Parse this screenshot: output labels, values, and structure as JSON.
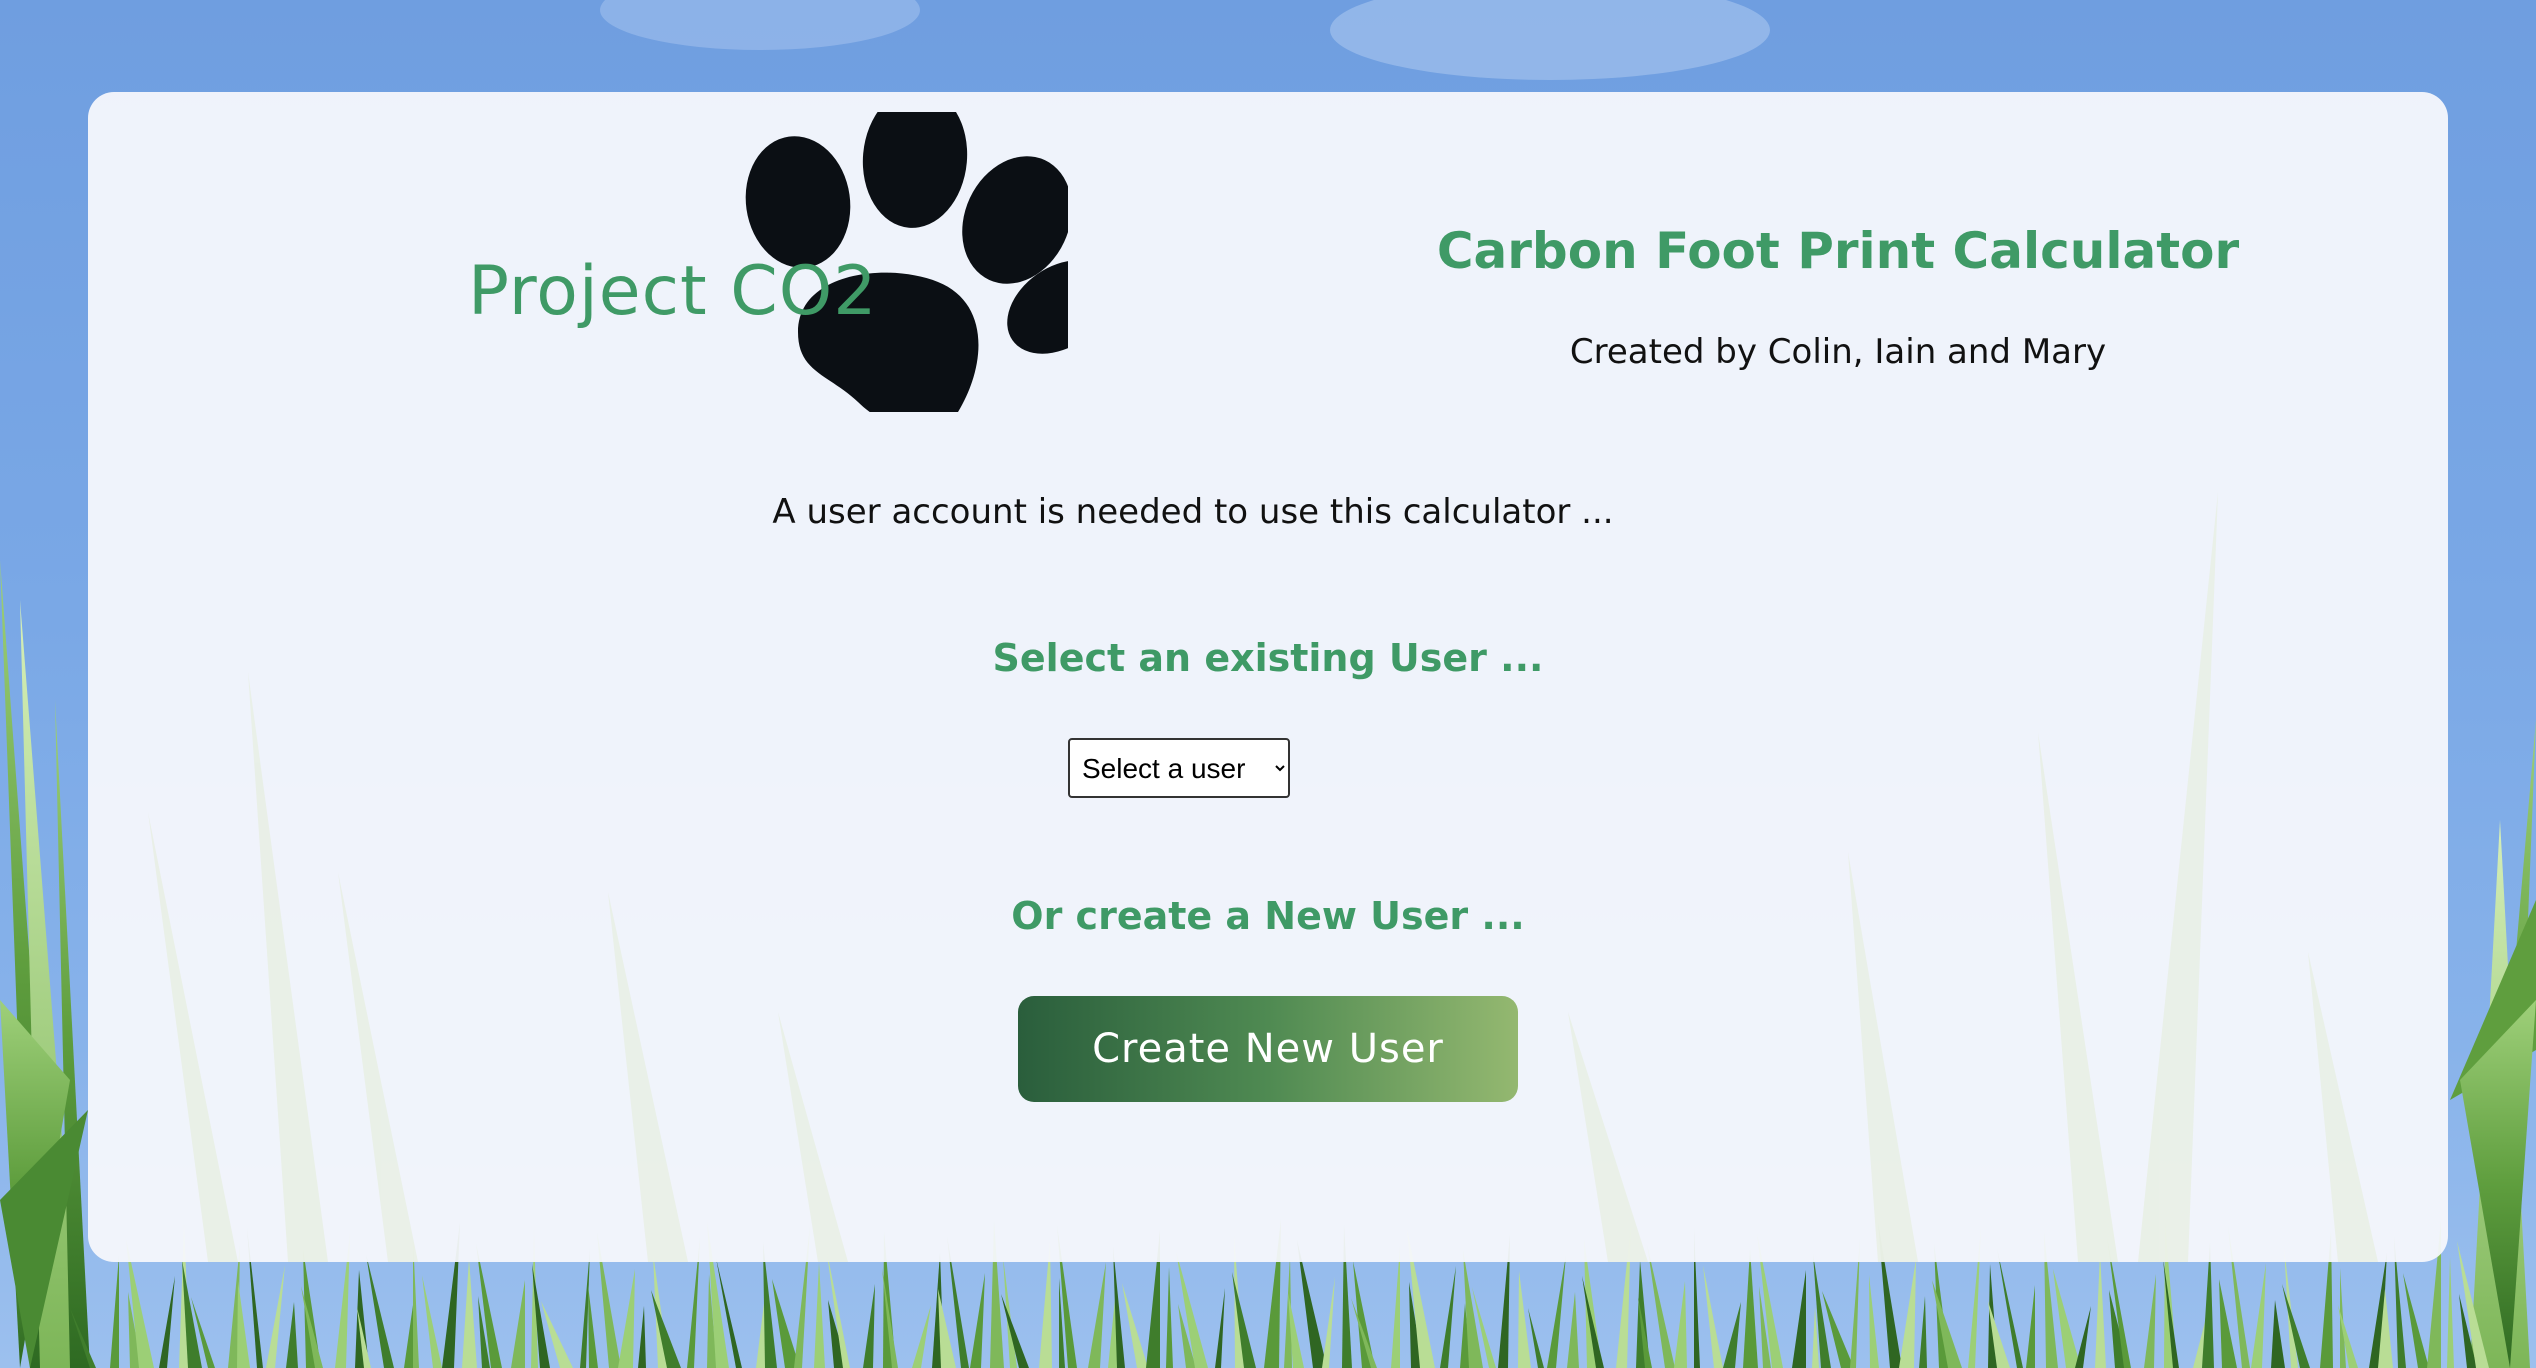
{
  "logo": {
    "text_project": "Project",
    "text_co2": "CO2"
  },
  "header": {
    "title": "Carbon Foot Print Calculator",
    "subtitle": "Created by Colin, Iain and Mary"
  },
  "main": {
    "notice": "A user account is needed to use this calculator ...",
    "select_heading": "Select an existing User ...",
    "user_select": {
      "selected": "Select a user",
      "options": [
        "Select a user"
      ]
    },
    "create_heading": "Or create a New User ...",
    "create_button_label": "Create New User"
  },
  "colors": {
    "accent_green": "#3f9a66",
    "sky_blue": "#6f9ee0",
    "button_gradient_start": "#2a5e3c",
    "button_gradient_end": "#94b870"
  },
  "icons": {
    "logo_mark": "paw-print-icon",
    "select_arrow": "chevron-down-icon"
  }
}
